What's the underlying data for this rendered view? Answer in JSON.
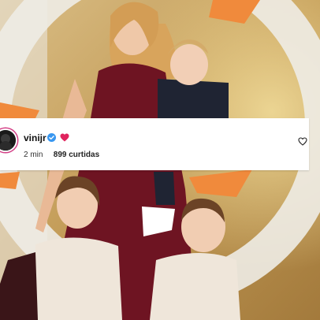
{
  "post": {
    "username": "vinijr",
    "time": "2 min",
    "likes": "899 curtidas"
  },
  "icons": {
    "verified": "verified-badge-icon",
    "reaction": "heart-icon",
    "like": "heart-outline-icon"
  },
  "colors": {
    "verified_blue": "#3897f0",
    "heart_red": "#e0245e",
    "story_ring": "#d33f86",
    "dress": "#6e1422",
    "background_gold": "#c9a86a",
    "ring_orange": "#f08a3c"
  }
}
